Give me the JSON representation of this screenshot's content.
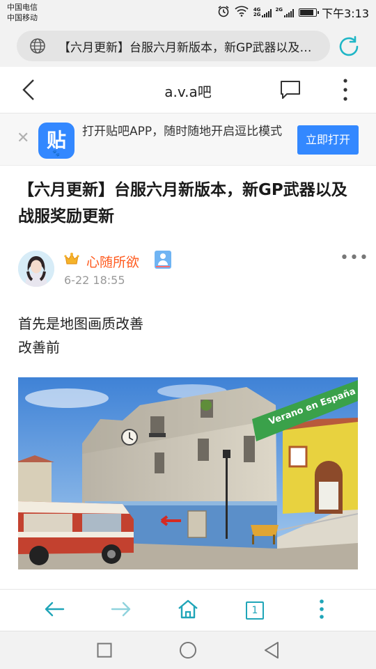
{
  "status_bar": {
    "carrier_1": "中国电信",
    "carrier_2": "中国移动",
    "network_1": "4G",
    "network_2": "2G",
    "network_3": "2G",
    "time": "下午3:13",
    "icons": [
      "alarm-icon",
      "wifi-icon",
      "signal-icon",
      "battery-icon"
    ]
  },
  "browser": {
    "url_title": "【六月更新】台服六月新版本，新GP武器以及战服奖励更新",
    "refresh_icon_color": "#1fb6c6",
    "nav": {
      "back_icon": "back-arrow-icon",
      "forward_icon": "forward-arrow-icon",
      "home_icon": "home-icon",
      "tabs_count": "1",
      "menu_icon": "more-vertical-icon",
      "accent": "#1fa5b8"
    }
  },
  "header": {
    "title": "a.v.a吧"
  },
  "app_banner": {
    "icon_char": "贴",
    "text": "打开贴吧APP，随时随地开启逗比模式",
    "button": "立即打开",
    "accent": "#3388ff"
  },
  "post": {
    "title": "【六月更新】台服六月新版本，新GP武器以及战服奖励更新",
    "author": "心随所欲",
    "date": "6-22 18:55",
    "username_color": "#ff5a1e",
    "body_lines": [
      "首先是地图画质改善",
      "改善前"
    ],
    "image_banner_text": "Verano en España"
  }
}
